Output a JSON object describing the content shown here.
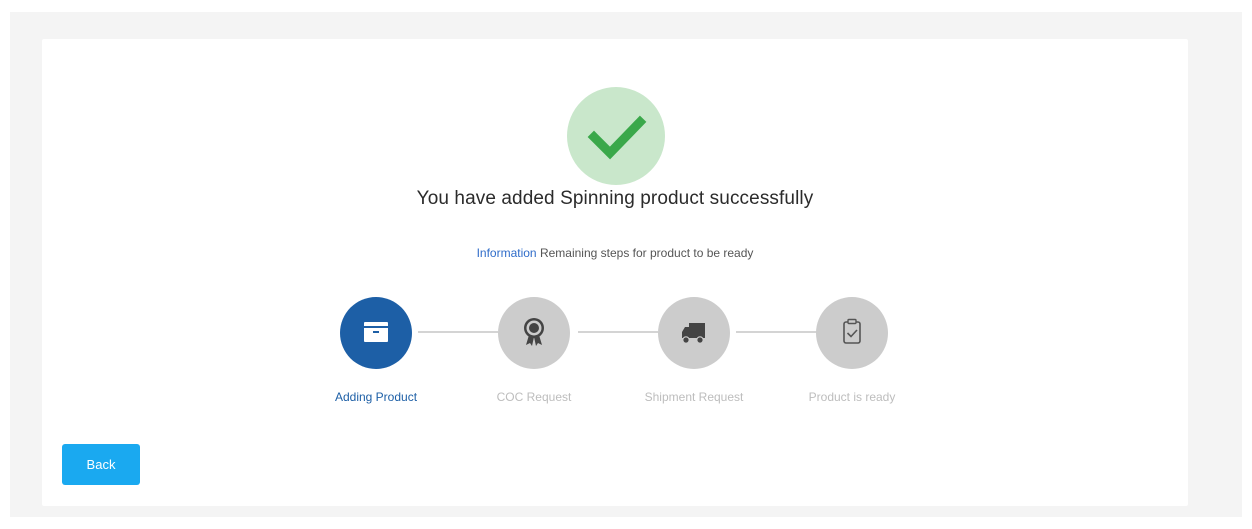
{
  "success": {
    "icon": "checkmark-icon",
    "message": "You have added Spinning product successfully"
  },
  "info": {
    "label": "Information",
    "text": "Remaining steps for product to be ready"
  },
  "steps": [
    {
      "label": "Adding Product",
      "icon": "archive-box-icon",
      "state": "active"
    },
    {
      "label": "COC Request",
      "icon": "certificate-badge-icon",
      "state": "pending"
    },
    {
      "label": "Shipment Request",
      "icon": "truck-icon",
      "state": "pending"
    },
    {
      "label": "Product is ready",
      "icon": "clipboard-check-icon",
      "state": "pending"
    }
  ],
  "actions": {
    "back_label": "Back"
  },
  "colors": {
    "primary": "#1d5fa6",
    "button": "#1aa9f0",
    "success_bg": "#c9e7cb",
    "success_check": "#3aa84a",
    "inactive": "#cccccc",
    "info_label": "#2f6cc9"
  }
}
